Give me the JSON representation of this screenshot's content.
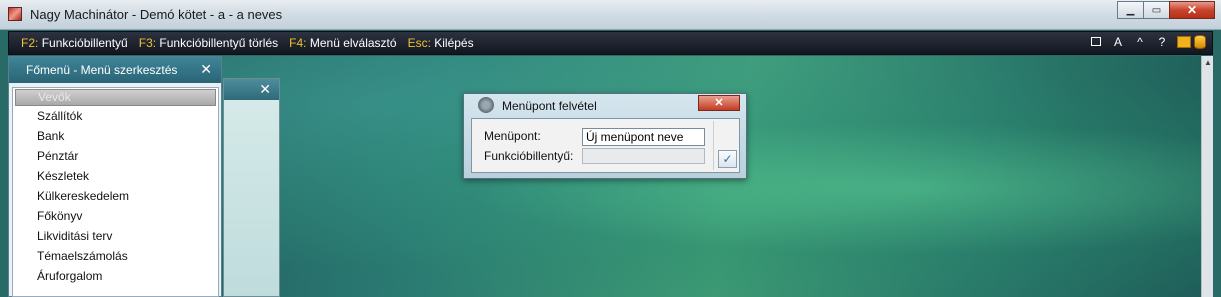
{
  "window": {
    "title": "Nagy Machinátor - Demó kötet - a - a neves"
  },
  "fkeybar": {
    "items": [
      {
        "key": "F2:",
        "label": "Funkcióbillentyű"
      },
      {
        "key": "F3:",
        "label": "Funkcióbillentyű törlés"
      },
      {
        "key": "F4:",
        "label": "Menü elválasztó"
      },
      {
        "key": "Esc:",
        "label": "Kilépés"
      }
    ],
    "tools": [
      "A",
      "^",
      "?"
    ]
  },
  "menu_panel": {
    "title": "Főmenü - Menü szerkesztés",
    "close": "✕",
    "items": [
      "Vevők",
      "Szállítók",
      "Bank",
      "Pénztár",
      "Készletek",
      "Külkereskedelem",
      "Főkönyv",
      "Likviditási terv",
      "Témaelszámolás",
      "Áruforgalom"
    ]
  },
  "back_panel": {
    "close": "✕"
  },
  "dialog": {
    "title": "Menüpont felvétel",
    "close": "✕",
    "field1_label": "Menüpont:",
    "field1_value": "Új menüpont neve",
    "field2_label": "Funkcióbillentyű:",
    "ok": "✓"
  }
}
